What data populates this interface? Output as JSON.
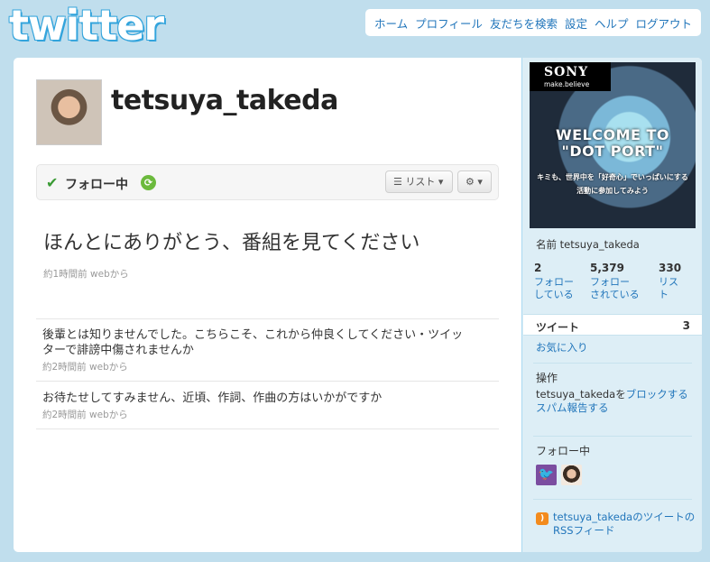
{
  "brand": {
    "logo_text": "twitter",
    "accent": "#2276bb",
    "background": "#c0deed"
  },
  "topnav": {
    "items": [
      "ホーム",
      "プロフィール",
      "友だちを検索",
      "設定",
      "ヘルプ",
      "ログアウト"
    ]
  },
  "profile": {
    "screen_name": "tetsuya_takeda",
    "follow_status": "フォロー中",
    "list_button": "リスト"
  },
  "tweets": [
    {
      "text": "ほんとにありがとう、番組を見てください",
      "meta": "約1時間前 webから"
    },
    {
      "text": "後輩とは知りませんでした。こちらこそ、これから仲良くしてください・ツイッターで誹謗中傷されませんか",
      "meta": "約2時間前 webから"
    },
    {
      "text": "お待たせしてすみません、近頃、作詞、作曲の方はいかがですか",
      "meta": "約2時間前 webから"
    }
  ],
  "ad": {
    "brand": "SONY",
    "tagline": "make.believe",
    "headline_1": "WELCOME TO",
    "headline_2": "\"DOT PORT\"",
    "line_1": "キミも、世界中を「好奇心」でいっぱいにする",
    "line_2": "活動に参加してみよう"
  },
  "sidebar": {
    "name_line": "名前 tetsuya_takeda",
    "stats": [
      {
        "num": "2",
        "label": "フォロー している"
      },
      {
        "num": "5,379",
        "label": "フォロー されている"
      },
      {
        "num": "330",
        "label": "リスト"
      }
    ],
    "tweets_label": "ツイート",
    "tweets_count": "3",
    "favorites": "お気に入り",
    "actions_heading": "操作",
    "actions_text": "tetsuya_takedaを",
    "block_link": "ブロックする",
    "spam_link": "スパム報告する",
    "following_heading": "フォロー中",
    "rss_link": "tetsuya_takedaのツイートのRSSフィード"
  }
}
